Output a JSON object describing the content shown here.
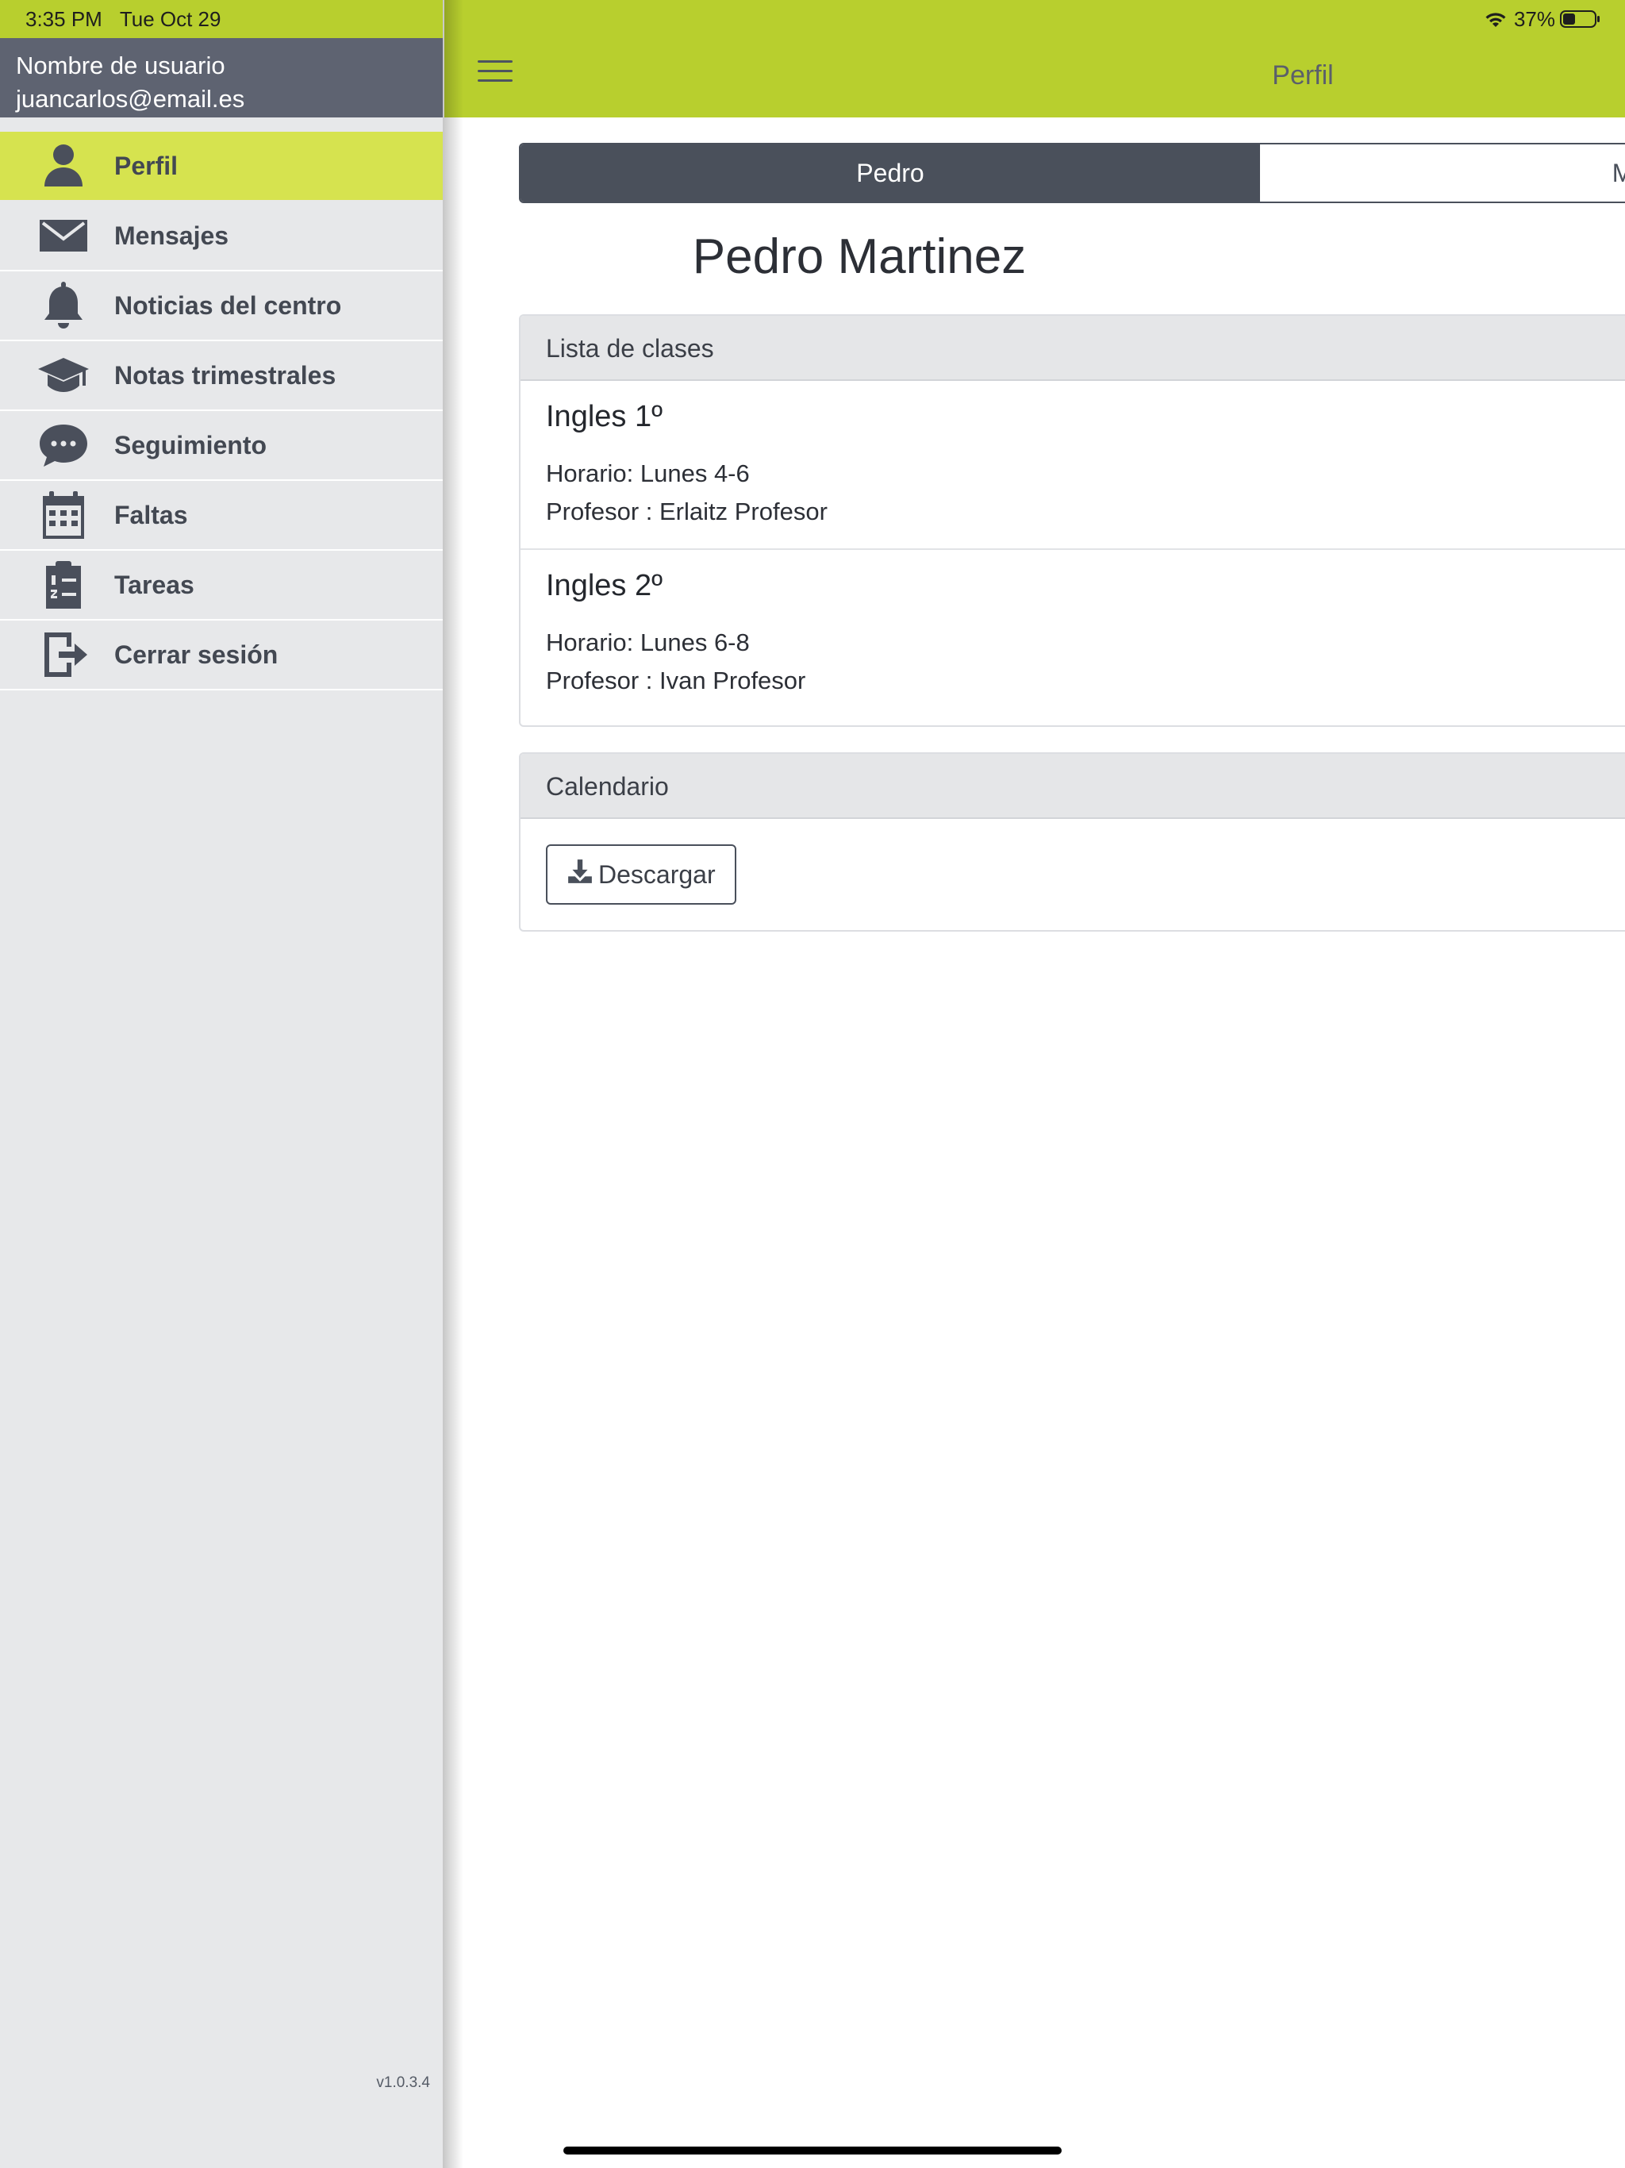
{
  "status_bar": {
    "time": "3:35 PM",
    "date": "Tue Oct 29",
    "battery": "37%",
    "icons": [
      "wifi-icon",
      "battery-icon"
    ]
  },
  "sidebar": {
    "user_label": "Nombre de usuario",
    "user_email": "juancarlos@email.es",
    "items": [
      {
        "label": "Perfil",
        "icon": "person-icon",
        "active": true
      },
      {
        "label": "Mensajes",
        "icon": "envelope-icon",
        "active": false
      },
      {
        "label": "Noticias del centro",
        "icon": "bell-icon",
        "active": false
      },
      {
        "label": "Notas trimestrales",
        "icon": "graduation-cap-icon",
        "active": false
      },
      {
        "label": "Seguimiento",
        "icon": "chat-bubble-icon",
        "active": false
      },
      {
        "label": "Faltas",
        "icon": "calendar-icon",
        "active": false
      },
      {
        "label": "Tareas",
        "icon": "clipboard-list-icon",
        "active": false
      },
      {
        "label": "Cerrar sesión",
        "icon": "sign-out-icon",
        "active": false
      }
    ],
    "version": "v1.0.3.4"
  },
  "header": {
    "title": "Perfil",
    "menu_icon": "hamburger-icon"
  },
  "tabs": [
    {
      "label": "Pedro",
      "active": true
    },
    {
      "label": "Ma",
      "active": false
    }
  ],
  "student": {
    "name": "Pedro Martinez"
  },
  "classes_card": {
    "header": "Lista de clases",
    "classes": [
      {
        "title": "Ingles 1º",
        "schedule": "Horario: Lunes 4-6",
        "teacher": "Profesor : Erlaitz Profesor"
      },
      {
        "title": "Ingles 2º",
        "schedule": "Horario: Lunes 6-8",
        "teacher": "Profesor : Ivan Profesor"
      }
    ]
  },
  "calendar_card": {
    "header": "Calendario",
    "download_label": "Descargar",
    "download_icon": "download-icon"
  },
  "colors": {
    "brand": "#b8cf2e",
    "active_item": "#d6e34f",
    "dark": "#4a505b"
  }
}
